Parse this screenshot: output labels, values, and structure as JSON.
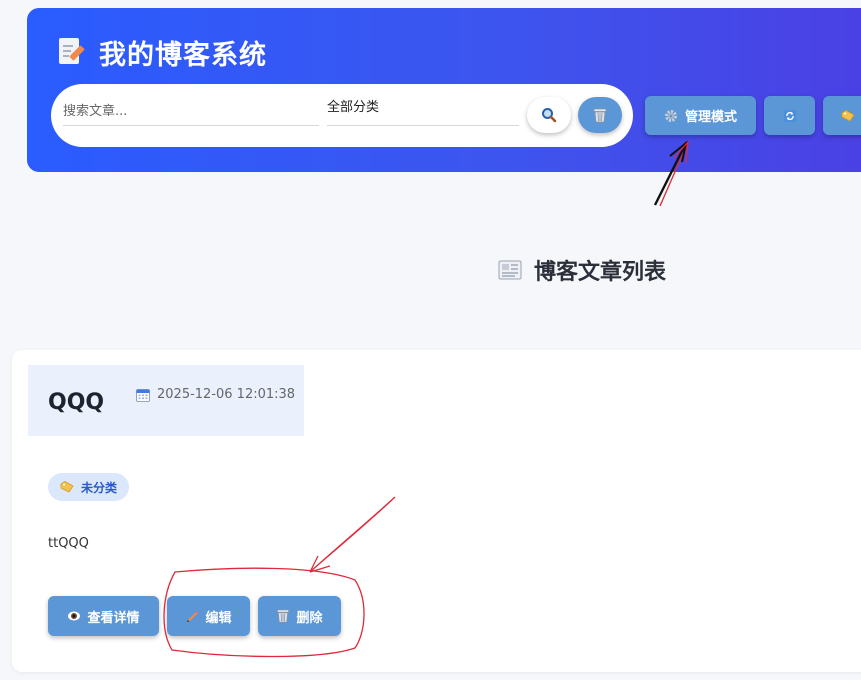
{
  "header": {
    "title": "我的博客系统",
    "search_placeholder": "搜索文章...",
    "category_selected": "全部分类",
    "admin_button": "管理模式",
    "brand_gradient": [
      "#2a5cff",
      "#4b3fe3"
    ],
    "button_color": "#5b97d6"
  },
  "main": {
    "list_title": "博客文章列表"
  },
  "post": {
    "title": "QQQ",
    "date": "2025-12-06 12:01:38",
    "tag": "未分类",
    "content": "ttQQQ",
    "actions": {
      "view": "查看详情",
      "edit": "编辑",
      "delete": "删除"
    }
  },
  "icons": {
    "title": "memo-icon",
    "search": "magnifier-icon",
    "clear": "wastebasket-icon",
    "admin": "gear-icon",
    "refresh": "refresh-icon",
    "tag": "tag-icon",
    "list": "newspaper-icon",
    "date": "calendar-icon",
    "view": "eye-icon",
    "edit": "pencil-icon",
    "delete": "wastebasket-icon"
  },
  "annotation_color": "#e0293a"
}
